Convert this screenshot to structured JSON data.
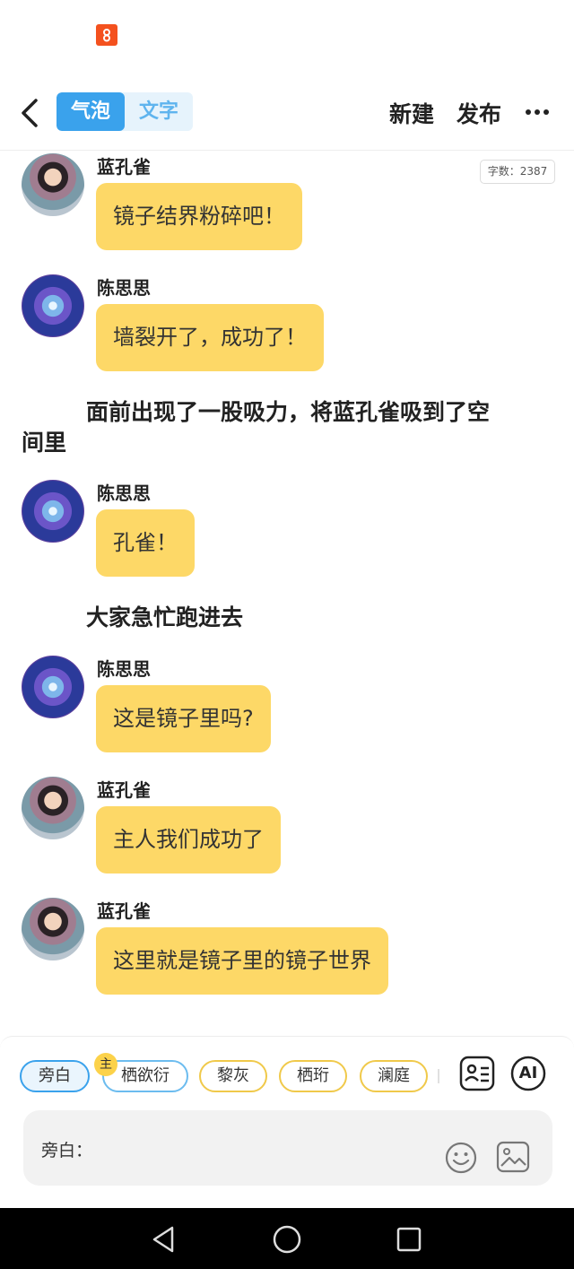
{
  "header": {
    "back_label": "back",
    "tabs": [
      {
        "label": "气泡",
        "active": true
      },
      {
        "label": "文字",
        "active": false
      }
    ],
    "new_label": "新建",
    "publish_label": "发布"
  },
  "word_count": "字数：2387",
  "messages": [
    {
      "type": "bubble",
      "sender": "蓝孔雀",
      "avatar": "blue-peacock-avatar",
      "text": "镜子结界粉碎吧！"
    },
    {
      "type": "bubble",
      "sender": "陈思思",
      "avatar": "chen-sisi-avatar",
      "text": "墙裂开了，成功了！"
    },
    {
      "type": "narration",
      "text_line1": "面前出现了一股吸力，将蓝孔雀吸到了空",
      "text_line2": "间里"
    },
    {
      "type": "bubble",
      "sender": "陈思思",
      "avatar": "chen-sisi-avatar",
      "text": "孔雀！"
    },
    {
      "type": "narration",
      "text": "大家急忙跑进去"
    },
    {
      "type": "bubble",
      "sender": "陈思思",
      "avatar": "chen-sisi-avatar",
      "text": "这是镜子里吗?"
    },
    {
      "type": "bubble",
      "sender": "蓝孔雀",
      "avatar": "blue-peacock-avatar",
      "text": "主人我们成功了"
    },
    {
      "type": "bubble",
      "sender": "蓝孔雀",
      "avatar": "blue-peacock-avatar",
      "text": "这里就是镜子里的镜子世界"
    }
  ],
  "role_chips": [
    {
      "label": "旁白",
      "selected": true
    },
    {
      "label": "栖欲衍",
      "badge": "主"
    },
    {
      "label": "黎灰"
    },
    {
      "label": "栖珩"
    },
    {
      "label": "澜庭"
    }
  ],
  "tools": {
    "ai_label": "AI"
  },
  "input": {
    "label": "旁白："
  },
  "colors": {
    "accent": "#3aa2ec",
    "bubble": "#fdd867",
    "chip_border": "#f0c94a"
  }
}
